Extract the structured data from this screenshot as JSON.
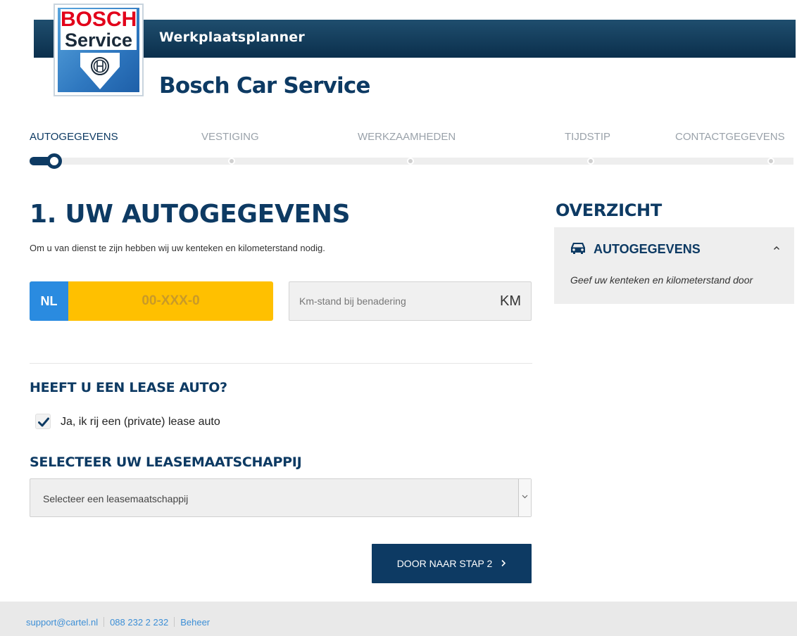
{
  "header": {
    "app_title": "Werkplaatsplanner",
    "brand_title": "Bosch Car Service",
    "logo": {
      "line1": "BOSCH",
      "line2": "Service"
    }
  },
  "steps": [
    {
      "label": "AUTOGEGEVENS",
      "active": true
    },
    {
      "label": "VESTIGING",
      "active": false
    },
    {
      "label": "WERKZAAMHEDEN",
      "active": false
    },
    {
      "label": "TIJDSTIP",
      "active": false
    },
    {
      "label": "CONTACTGEGEVENS",
      "active": false
    }
  ],
  "main": {
    "heading": "1. UW AUTOGEGEVENS",
    "intro": "Om u van dienst te zijn hebben wij uw kenteken en kilometerstand nodig.",
    "plate": {
      "country": "NL",
      "value": "",
      "placeholder": "00-XXX-0"
    },
    "mileage": {
      "value": "",
      "placeholder": "Km-stand bij benadering",
      "unit": "KM"
    },
    "lease": {
      "heading": "HEEFT U EEN LEASE AUTO?",
      "checkbox_label": "Ja, ik rij een (private) lease auto",
      "checked": true
    },
    "lease_company": {
      "heading": "SELECTEER UW LEASEMAATSCHAPPIJ",
      "selected": "Selecteer een leasemaatschappij"
    },
    "next_button": "DOOR NAAR STAP 2"
  },
  "sidebar": {
    "title": "OVERZICHT",
    "section": {
      "icon": "car-icon",
      "heading": "AUTOGEGEVENS",
      "description": "Geef uw kenteken en kilometerstand door"
    }
  },
  "footer": {
    "email": "support@cartel.nl",
    "phone": "088 232 2 232",
    "admin": "Beheer"
  },
  "colors": {
    "primary": "#0d3a63",
    "plate_yellow": "#ffc000",
    "plate_blue": "#2a8be0",
    "link": "#3d8fd6",
    "bosch_red": "#e2001a"
  }
}
